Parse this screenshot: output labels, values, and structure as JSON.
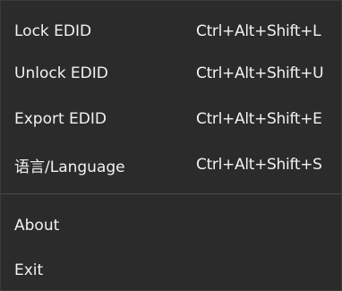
{
  "menu": {
    "items": [
      {
        "label": "Lock EDID",
        "shortcut": "Ctrl+Alt+Shift+L"
      },
      {
        "label": "Unlock EDID",
        "shortcut": "Ctrl+Alt+Shift+U"
      },
      {
        "label": "Export EDID",
        "shortcut": "Ctrl+Alt+Shift+E"
      },
      {
        "label": "语言/Language",
        "shortcut": "Ctrl+Alt+Shift+S"
      },
      {
        "label": "About",
        "shortcut": ""
      },
      {
        "label": "Exit",
        "shortcut": ""
      }
    ]
  },
  "colors": {
    "background": "#2b2b2b",
    "text": "#f2f2f2",
    "separator": "#4a4a4a"
  }
}
